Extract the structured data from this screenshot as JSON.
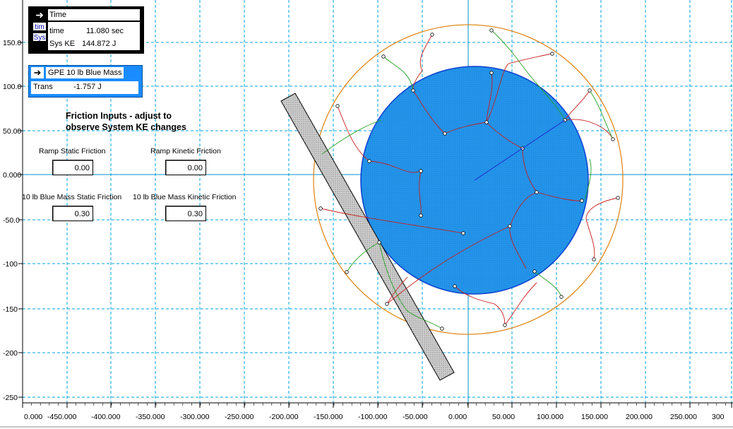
{
  "time_panel": {
    "title": "Time",
    "side_tabs": [
      "tim",
      "Sys"
    ],
    "rows": [
      {
        "label": "time",
        "value": "11.080 sec"
      },
      {
        "label": "Sys KE",
        "value": "144.872 J"
      }
    ]
  },
  "gpe_panel": {
    "title": "GPE 10 lb Blue Mass",
    "row": {
      "label": "Trans",
      "value": "-1.757 J"
    }
  },
  "friction": {
    "heading_line1": "Friction Inputs - adjust to",
    "heading_line2": "observe System KE changes",
    "ramp_static_label": "Ramp Static Friction",
    "ramp_static_value": "0.00",
    "ramp_kinetic_label": "Ramp Kinetic Friction",
    "ramp_kinetic_value": "0.00",
    "mass_static_label": "10 lb Blue Mass Static Friction",
    "mass_static_value": "0.30",
    "mass_kinetic_label": "10 lb Blue Mass Kinetic Friction",
    "mass_kinetic_value": "0.30"
  },
  "axes": {
    "y_ticks": [
      "150.0",
      "100.0",
      "50.00",
      "0.000",
      "-50.0",
      "-100",
      "-150",
      "-200",
      "-250"
    ],
    "x_ticks": [
      "0.000",
      "-450.000",
      "-400.000",
      "-350.000",
      "-300.000",
      "-250.000",
      "-200.000",
      "-150.000",
      "-100.000",
      "-50.000",
      "0.000",
      "50.000",
      "100.000",
      "150.000",
      "200.000",
      "250.000",
      "300"
    ]
  },
  "colors": {
    "grid": "#00a0e0",
    "disk": "#1f8fe6",
    "disk_border": "#0b3fcf",
    "orbit": "#e08a1e",
    "ramp_fill": "#c8c8c8",
    "trail_red": "#c81e1e",
    "trail_green": "#22a022",
    "axis_line": "#0090d0"
  }
}
